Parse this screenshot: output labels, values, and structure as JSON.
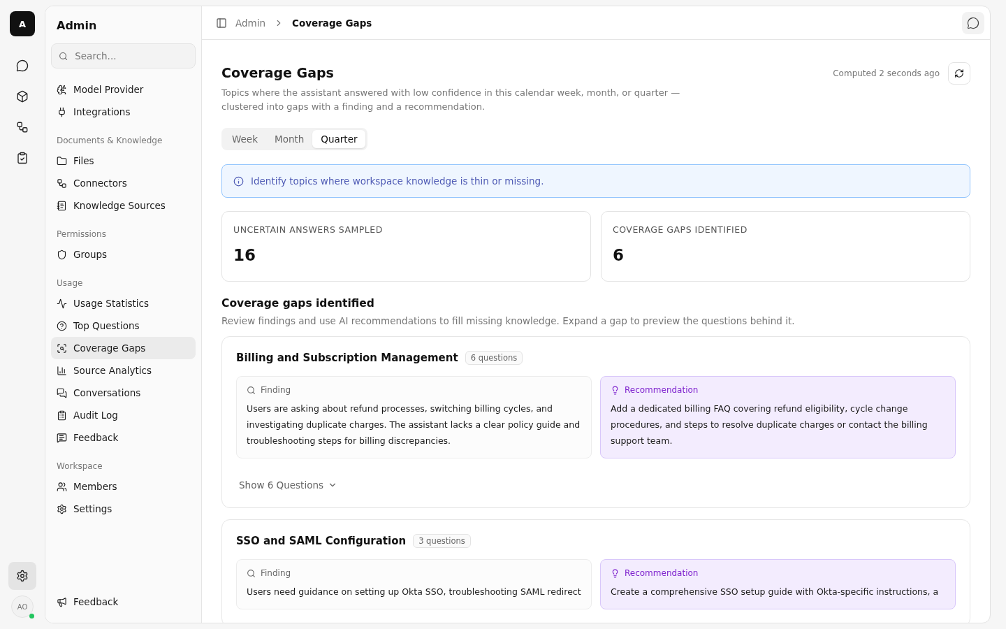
{
  "rail": {
    "logo": "A",
    "settings": {
      "selected": true
    },
    "avatar": {
      "initials": "AO",
      "online": true
    }
  },
  "sidebar": {
    "title": "Admin",
    "search": {
      "placeholder": "Search..."
    },
    "sections": [
      {
        "items": [
          {
            "label": "Model Provider",
            "selected": false
          },
          {
            "label": "Integrations",
            "selected": false
          }
        ]
      },
      {
        "heading": "Documents & Knowledge",
        "items": [
          {
            "label": "Files",
            "selected": false
          },
          {
            "label": "Connectors",
            "selected": false
          },
          {
            "label": "Knowledge Sources",
            "selected": false
          }
        ]
      },
      {
        "heading": "Permissions",
        "items": [
          {
            "label": "Groups",
            "selected": false
          }
        ]
      },
      {
        "heading": "Usage",
        "items": [
          {
            "label": "Usage Statistics",
            "selected": false
          },
          {
            "label": "Top Questions",
            "selected": false
          },
          {
            "label": "Coverage Gaps",
            "selected": true
          },
          {
            "label": "Source Analytics",
            "selected": false
          },
          {
            "label": "Conversations",
            "selected": false
          },
          {
            "label": "Audit Log",
            "selected": false
          },
          {
            "label": "Feedback",
            "selected": false
          }
        ]
      },
      {
        "heading": "Workspace",
        "items": [
          {
            "label": "Members",
            "selected": false
          },
          {
            "label": "Settings",
            "selected": false
          }
        ]
      }
    ],
    "footer": {
      "label": "Feedback"
    }
  },
  "breadcrumb": [
    "Admin",
    "Coverage Gaps"
  ],
  "page": {
    "title": "Coverage Gaps",
    "subtitle": "Topics where the assistant answered with low confidence in this calendar week, month, or quarter — clustered into gaps with a finding and a recommendation.",
    "computed": "Computed 2 seconds ago",
    "tabs": [
      {
        "label": "Week",
        "selected": false
      },
      {
        "label": "Month",
        "selected": false
      },
      {
        "label": "Quarter",
        "selected": true
      }
    ],
    "banner": "Identify topics where workspace knowledge is thin or missing.",
    "stats": [
      {
        "label": "UNCERTAIN ANSWERS SAMPLED",
        "value": "16"
      },
      {
        "label": "COVERAGE GAPS IDENTIFIED",
        "value": "6"
      }
    ],
    "section": {
      "title": "Coverage gaps identified",
      "description": "Review findings and use AI recommendations to fill missing knowledge. Expand a gap to preview the questions behind it."
    },
    "gaps": [
      {
        "title": "Billing and Subscription Management",
        "count": "6 questions",
        "finding": {
          "label": "Finding",
          "text": "Users are asking about refund processes, switching billing cycles, and investigating duplicate charges. The assistant lacks a clear policy guide and troubleshooting steps for billing discrepancies."
        },
        "recommendation": {
          "label": "Recommendation",
          "text": "Add a dedicated billing FAQ covering refund eligibility, cycle change procedures, and steps to resolve duplicate charges or contact the billing support team."
        },
        "toggle": "Show 6 Questions"
      },
      {
        "title": "SSO and SAML Configuration",
        "count": "3 questions",
        "finding": {
          "label": "Finding",
          "text": "Users need guidance on setting up Okta SSO, troubleshooting SAML redirect"
        },
        "recommendation": {
          "label": "Recommendation",
          "text": "Create a comprehensive SSO setup guide with Okta-specific instructions, a"
        }
      }
    ]
  }
}
